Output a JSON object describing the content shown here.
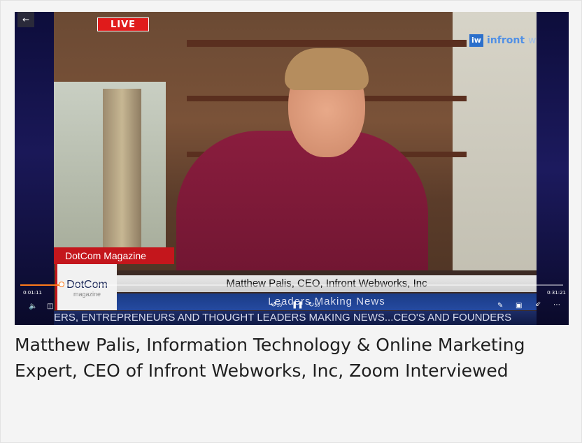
{
  "video": {
    "live_badge": "LIVE",
    "brand_logo": {
      "mark": "iw",
      "name_bold": "infront",
      "name_light": "webworks"
    },
    "dotcom_red_label": "DotCom Magazine",
    "dotcom_logo": {
      "line1": "DotCom",
      "line2": "magazine"
    },
    "lower_third": "Matthew Palis, CEO, Infront Webworks, Inc",
    "tagline": "Leaders Making News",
    "ticker": "ERS, ENTREPRENEURS AND THOUGHT LEADERS MAKING NEWS...CEO'S AND FOUNDERS"
  },
  "player": {
    "elapsed": "0:01:11",
    "duration": "0:31:21",
    "progress": 0.038,
    "icons": {
      "back": "back-arrow-icon",
      "volume": "volume-icon",
      "captions": "captions-icon",
      "rewind": "rewind-10-icon",
      "play_pause": "pause-icon",
      "forward": "forward-30-icon",
      "edit": "pen-icon",
      "miniplayer": "miniplayer-icon",
      "fullscreen": "collapse-icon",
      "more": "more-icon"
    },
    "rewind_label": "10",
    "forward_label": "30",
    "accent_color": "#ff7a1a"
  },
  "caption": {
    "title": "Matthew Palis, Information Technology & Online Marketing Expert, CEO of Infront Webworks, Inc, Zoom Interviewed"
  }
}
